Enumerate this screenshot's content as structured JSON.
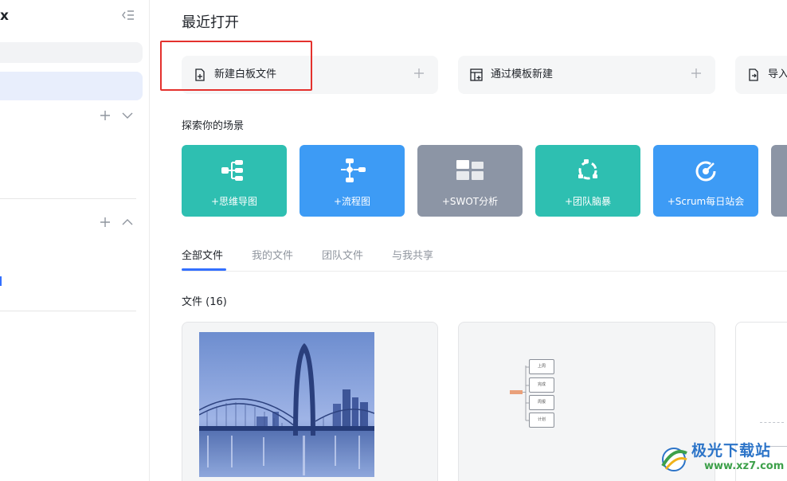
{
  "sidebar": {
    "app_name_fragment": "x",
    "search_fragment": ")"
  },
  "main": {
    "recent_title": "最近打开",
    "create_actions": [
      {
        "label": "新建白板文件",
        "icon": "new-file-icon"
      },
      {
        "label": "通过模板新建",
        "icon": "template-icon"
      },
      {
        "label": "导入",
        "icon": "import-icon"
      }
    ],
    "explore_title": "探索你的场景",
    "scenes": [
      {
        "label": "+思维导图",
        "icon": "mindmap-icon",
        "color": "#2ebfb1"
      },
      {
        "label": "+流程图",
        "icon": "flowchart-icon",
        "color": "#3d9bf5"
      },
      {
        "label": "+SWOT分析",
        "icon": "swot-icon",
        "color": "#8c95a5"
      },
      {
        "label": "+团队脑暴",
        "icon": "brainstorm-icon",
        "color": "#2ebfb1"
      },
      {
        "label": "+Scrum每日站会",
        "icon": "scrum-icon",
        "color": "#3d9bf5"
      }
    ],
    "tabs": [
      {
        "label": "全部文件",
        "active": true
      },
      {
        "label": "我的文件",
        "active": false
      },
      {
        "label": "团队文件",
        "active": false
      },
      {
        "label": "与我共享",
        "active": false
      }
    ],
    "files_count": "文件 (16)",
    "mindmap_nodes": [
      "上周",
      "完成",
      "周报",
      "计划"
    ]
  },
  "watermark": {
    "brand": "极光下载站",
    "url": "www.xz7.com"
  },
  "colors": {
    "accent": "#3370ff",
    "highlight": "#e4312d"
  }
}
